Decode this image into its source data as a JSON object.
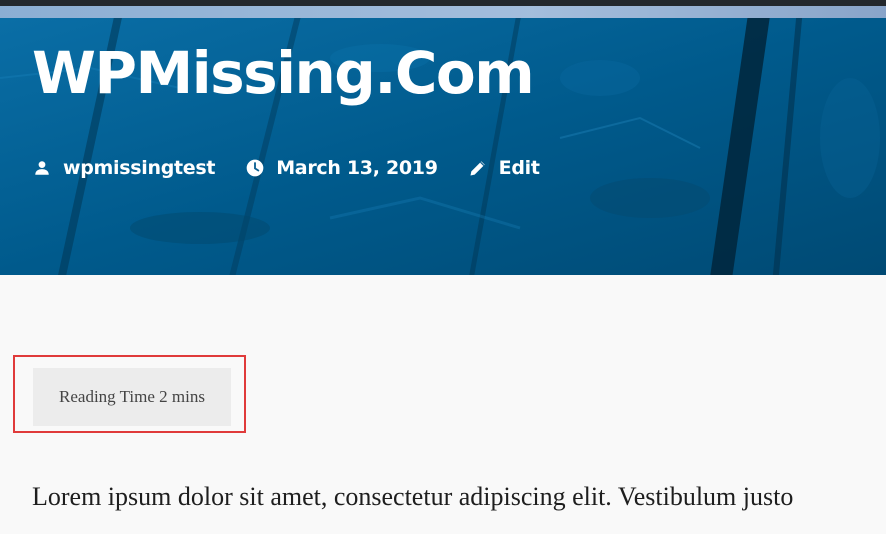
{
  "site": {
    "title": "WPMissing.Com"
  },
  "meta": {
    "author": "wpmissingtest",
    "date": "March 13, 2019",
    "edit_label": "Edit",
    "icons": [
      "person-icon",
      "clock-icon",
      "pencil-icon"
    ]
  },
  "reading_time": {
    "label": "Reading Time 2 mins"
  },
  "content": {
    "excerpt": "Lorem ipsum dolor sit amet, consectetur adipiscing elit. Vestibulum justo"
  },
  "colors": {
    "hero_blue": "#005a8c",
    "highlight_border": "#e03b3b",
    "reading_box_bg": "#ececec",
    "page_bg": "#f9f9f9"
  }
}
